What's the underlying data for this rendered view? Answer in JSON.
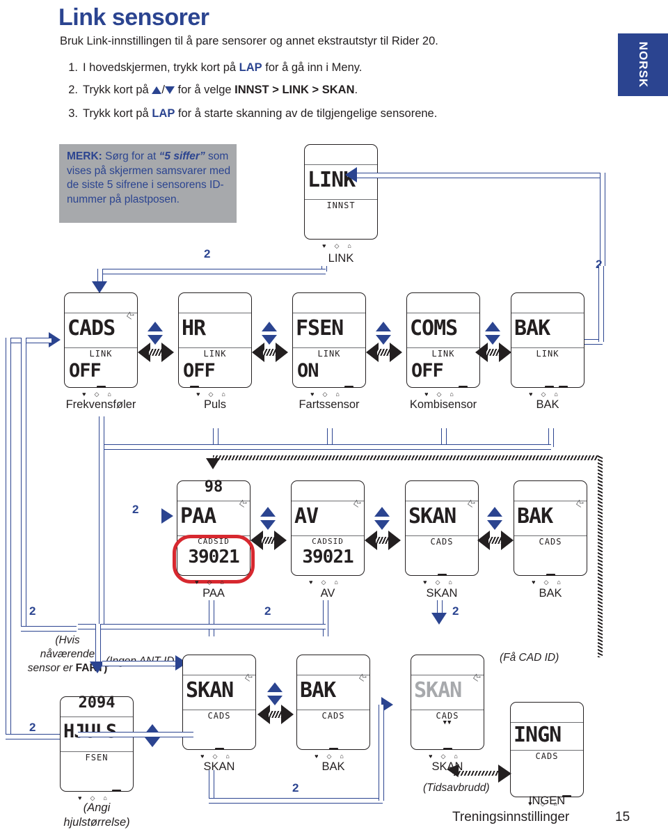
{
  "header": {
    "title": "Link sensorer",
    "intro": "Bruk Link-innstillingen til å pare sensorer og annet ekstrautstyr til Rider 20.",
    "steps": [
      {
        "num": "1.",
        "pre": "I hovedskjermen, trykk kort på ",
        "key": "LAP",
        "post": " for å gå inn i Meny."
      },
      {
        "num": "2.",
        "pre": "Trykk kort på ",
        "key": "",
        "post": " for å velge ",
        "sel": "INNST > LINK > SKAN",
        "end": "."
      },
      {
        "num": "3.",
        "pre": "Trykk kort på ",
        "key": "LAP",
        "post": " for å starte skanning av de tilgjengelige sensorene."
      }
    ]
  },
  "language_tab": {
    "label": "NORSK",
    "color": "#2b4490"
  },
  "note": {
    "prefix": "MERK:",
    "t1": " Sørg for at ",
    "quoted": "“5 siffer”",
    "t2": " som vises på skjermen samsvarer med de siste 5 sifrene i sensorens ID-nummer på plastposen.",
    "background": "#a7a9ac"
  },
  "screens": {
    "link": {
      "big": "LINK",
      "small": "INNST",
      "caption": "LINK"
    },
    "row1": [
      {
        "big": "CADS",
        "small": "LINK",
        "value": "OFF",
        "caption": "Frekvensføler",
        "tick": "mid"
      },
      {
        "big": "HR",
        "small": "LINK",
        "value": "OFF",
        "caption": "Puls",
        "tick": "left"
      },
      {
        "big": "FSEN",
        "small": "LINK",
        "value": "ON",
        "caption": "Fartssensor",
        "tick": "right"
      },
      {
        "big": "COMS",
        "small": "LINK",
        "value": "OFF",
        "caption": "Kombisensor",
        "tick": "right"
      },
      {
        "big": "BAK",
        "small": "LINK",
        "value": "",
        "caption": "BAK",
        "tick": "midright"
      }
    ],
    "row2": [
      {
        "top": "98",
        "big": "PAA",
        "small": "CADSID",
        "value": "39021",
        "caption": "PAA",
        "tick": ""
      },
      {
        "top": "",
        "big": "AV",
        "small": "CADSID",
        "value": "39021",
        "caption": "AV",
        "tick": ""
      },
      {
        "top": "",
        "big": "SKAN",
        "small": "CADS",
        "value": "",
        "caption": "SKAN",
        "tick": "mid"
      },
      {
        "top": "",
        "big": "BAK",
        "small": "CADS",
        "value": "",
        "caption": "BAK",
        "tick": "mid"
      }
    ],
    "row3": [
      {
        "top": "2094",
        "big": "HJULS",
        "small": "FSEN",
        "caption_l1": "(Angi",
        "caption_l2": "hjulstørrelse)",
        "tick": "right"
      },
      {
        "top": "",
        "big": "SKAN",
        "small": "CADS",
        "caption_l1": "SKAN",
        "caption_l2": "",
        "tick": "mid"
      },
      {
        "top": "",
        "big": "BAK",
        "small": "CADS",
        "caption_l1": "BAK",
        "caption_l2": "",
        "tick": "mid"
      },
      {
        "top": "",
        "big": "SKAN",
        "small": "CADS",
        "caption_l1": "SKAN",
        "caption_l2": "",
        "tick": "mid"
      },
      {
        "top": "",
        "big": "INGN",
        "small": "CADS",
        "caption_l1": "INGEN",
        "caption_l2": "",
        "tick": "right"
      }
    ]
  },
  "annotations": {
    "hvis_fart": "(Hvis nåværende sensor er FART)",
    "hvis_fart_l1": "(Hvis",
    "hvis_fart_l2": "nåværende",
    "hvis_fart_l3a": "sensor er ",
    "hvis_fart_l3b": "FART)",
    "ingen_ant_id": "(Ingen ANT ID)",
    "faa_cad_id": "(Få CAD ID)",
    "tidsavbrudd": "(Tidsavbrudd)",
    "button_label": "2"
  },
  "footer": {
    "chapter": "Treningsinnstillinger",
    "page": "15"
  },
  "colors": {
    "brand_blue": "#2b4490",
    "ink": "#231f20",
    "red_highlight": "#d7282f",
    "gray_note": "#a7a9ac"
  }
}
